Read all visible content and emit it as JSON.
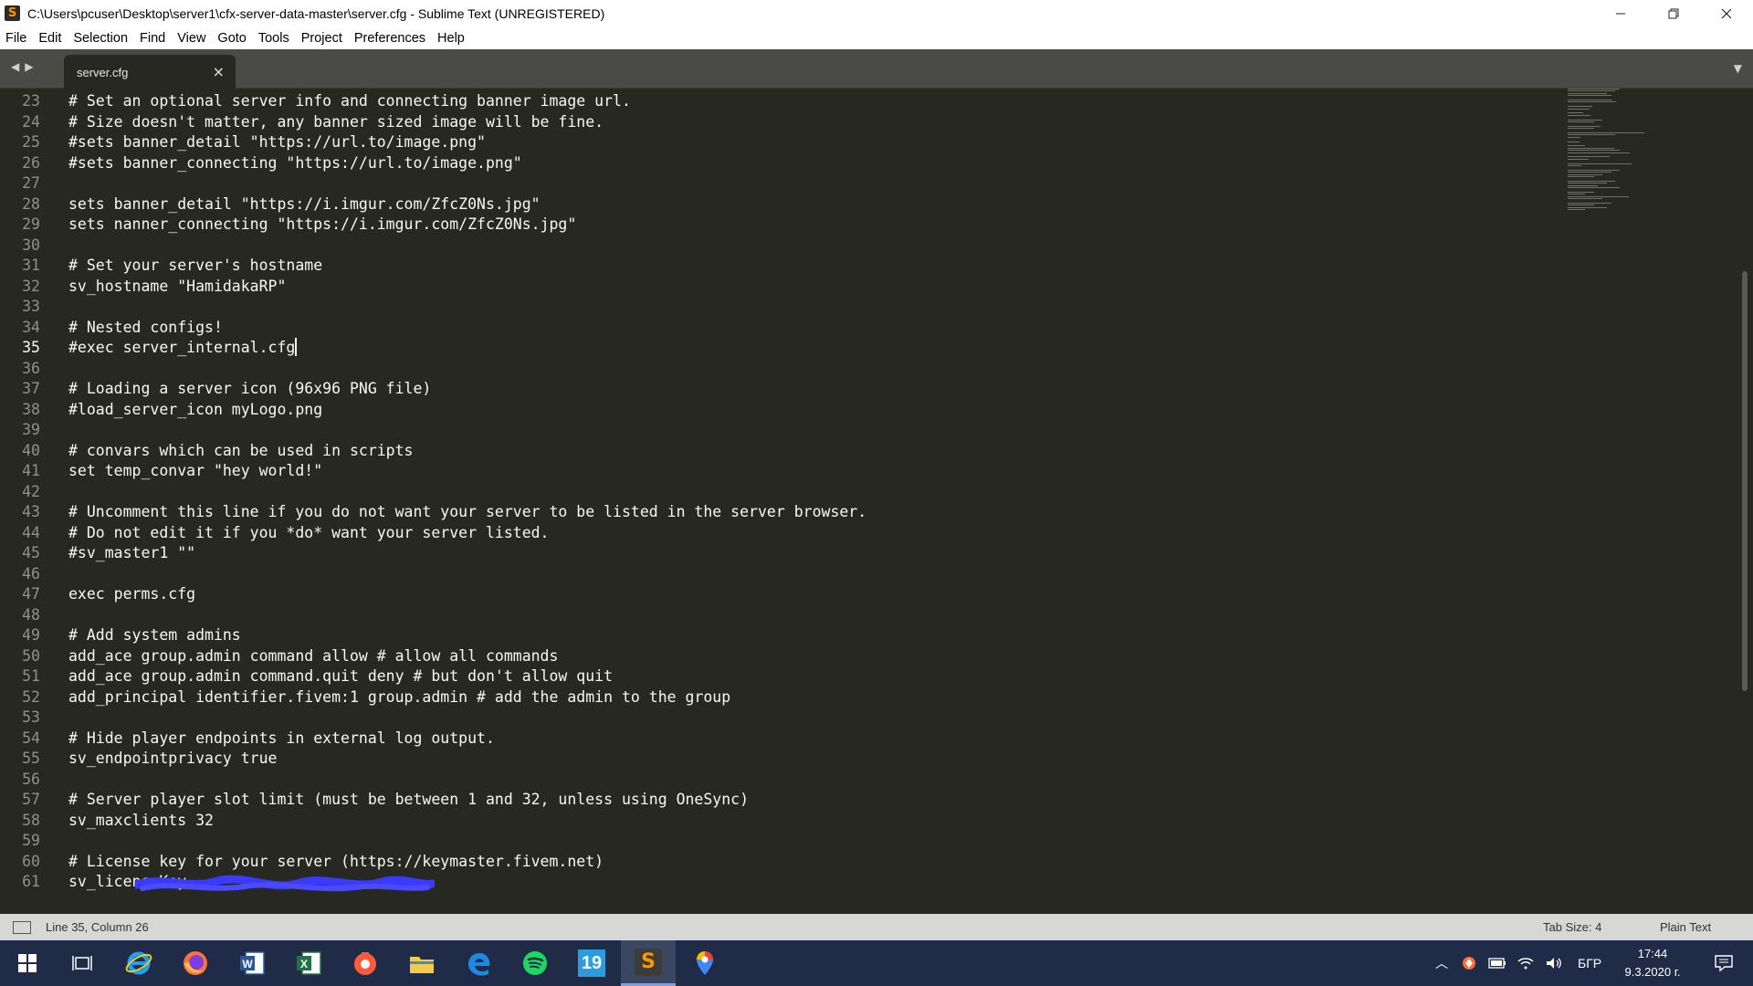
{
  "window": {
    "title": "C:\\Users\\pcuser\\Desktop\\server1\\cfx-server-data-master\\server.cfg - Sublime Text (UNREGISTERED)",
    "app_icon_letter": "S"
  },
  "menu": [
    "File",
    "Edit",
    "Selection",
    "Find",
    "View",
    "Goto",
    "Tools",
    "Project",
    "Preferences",
    "Help"
  ],
  "tab": {
    "label": "server.cfg",
    "close": "×"
  },
  "editor": {
    "current_line": 35,
    "lines": [
      {
        "n": "23",
        "text": "# Set an optional server info and connecting banner image url."
      },
      {
        "n": "24",
        "text": "# Size doesn't matter, any banner sized image will be fine."
      },
      {
        "n": "25",
        "text": "#sets banner_detail \"https://url.to/image.png\""
      },
      {
        "n": "26",
        "text": "#sets banner_connecting \"https://url.to/image.png\""
      },
      {
        "n": "27",
        "text": ""
      },
      {
        "n": "28",
        "text": "sets banner_detail \"https://i.imgur.com/ZfcZ0Ns.jpg\""
      },
      {
        "n": "29",
        "text": "sets nanner_connecting \"https://i.imgur.com/ZfcZ0Ns.jpg\""
      },
      {
        "n": "30",
        "text": ""
      },
      {
        "n": "31",
        "text": "# Set your server's hostname"
      },
      {
        "n": "32",
        "text": "sv_hostname \"HamidakaRP\""
      },
      {
        "n": "33",
        "text": ""
      },
      {
        "n": "34",
        "text": "# Nested configs!"
      },
      {
        "n": "35",
        "text": "#exec server_internal.cfg"
      },
      {
        "n": "36",
        "text": ""
      },
      {
        "n": "37",
        "text": "# Loading a server icon (96x96 PNG file)"
      },
      {
        "n": "38",
        "text": "#load_server_icon myLogo.png"
      },
      {
        "n": "39",
        "text": ""
      },
      {
        "n": "40",
        "text": "# convars which can be used in scripts"
      },
      {
        "n": "41",
        "text": "set temp_convar \"hey world!\""
      },
      {
        "n": "42",
        "text": ""
      },
      {
        "n": "43",
        "text": "# Uncomment this line if you do not want your server to be listed in the server browser."
      },
      {
        "n": "44",
        "text": "# Do not edit it if you *do* want your server listed."
      },
      {
        "n": "45",
        "text": "#sv_master1 \"\""
      },
      {
        "n": "46",
        "text": ""
      },
      {
        "n": "47",
        "text": "exec perms.cfg"
      },
      {
        "n": "48",
        "text": ""
      },
      {
        "n": "49",
        "text": "# Add system admins"
      },
      {
        "n": "50",
        "text": "add_ace group.admin command allow # allow all commands"
      },
      {
        "n": "51",
        "text": "add_ace group.admin command.quit deny # but don't allow quit"
      },
      {
        "n": "52",
        "text": "add_principal identifier.fivem:1 group.admin # add the admin to the group"
      },
      {
        "n": "53",
        "text": ""
      },
      {
        "n": "54",
        "text": "# Hide player endpoints in external log output."
      },
      {
        "n": "55",
        "text": "sv_endpointprivacy true"
      },
      {
        "n": "56",
        "text": ""
      },
      {
        "n": "57",
        "text": "# Server player slot limit (must be between 1 and 32, unless using OneSync)"
      },
      {
        "n": "58",
        "text": "sv_maxclients 32"
      },
      {
        "n": "59",
        "text": ""
      },
      {
        "n": "60",
        "text": "# License key for your server (https://keymaster.fivem.net)"
      },
      {
        "n": "61",
        "text": "sv_licenseKey"
      }
    ]
  },
  "status": {
    "position": "Line 35, Column 26",
    "tab_size": "Tab Size: 4",
    "syntax": "Plain Text"
  },
  "taskbar": {
    "apps": [
      {
        "name": "task-view-icon"
      },
      {
        "name": "internet-explorer-icon"
      },
      {
        "name": "firefox-icon"
      },
      {
        "name": "word-icon"
      },
      {
        "name": "excel-icon"
      },
      {
        "name": "screenshot-tool-icon"
      },
      {
        "name": "file-explorer-icon"
      },
      {
        "name": "edge-icon"
      },
      {
        "name": "spotify-icon"
      },
      {
        "name": "calendar-19-icon",
        "label": "19"
      },
      {
        "name": "sublime-text-icon",
        "label": "S",
        "active": true
      },
      {
        "name": "maps-pin-icon"
      }
    ],
    "language": "БГР",
    "time": "17:44",
    "date": "9.3.2020 г."
  },
  "colors": {
    "editor_bg": "#272822",
    "text": "#f8f8f2",
    "gutter_text": "#8f908a",
    "taskbar_bg": "#1f2b47",
    "redaction": "#3a3aff"
  }
}
